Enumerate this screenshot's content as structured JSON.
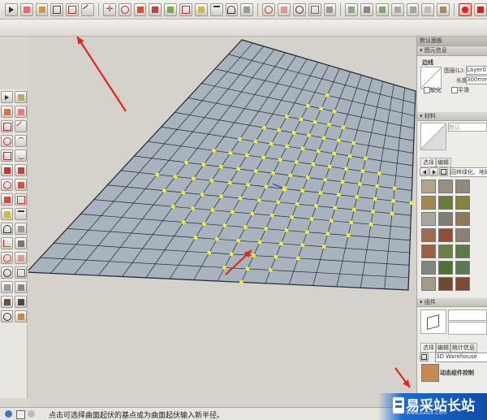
{
  "window": {
    "tray_title": "默认面板"
  },
  "entity_info": {
    "header": "图元信息",
    "type_label": "边线",
    "layer_label": "图层(L):",
    "layer_value": "Layer0",
    "length_label": "长度",
    "length_value": "300mm",
    "soften_label": "软化",
    "smooth_label": "平滑"
  },
  "materials": {
    "header": "材料",
    "name_placeholder": "默认",
    "tab_select": "选择",
    "tab_edit": "编辑",
    "library_value": "园林绿化、地砖",
    "swatches": [
      "#b6a489",
      "#958f84",
      "#8f8a7a",
      "#a0894e",
      "#6a7d3f",
      "#84853d",
      "#a7a69f",
      "#7e7e74",
      "#8b7b5c",
      "#a06a4e",
      "#8f4d3a",
      "#8b8178",
      "#9c5f43",
      "#6a8046",
      "#5b7a48",
      "#7e8780",
      "#4e6f36",
      "#5c7a52",
      "#a49a86",
      "#6f4a2f",
      "#7b4c32"
    ]
  },
  "components": {
    "header": "组件",
    "tab_select": "选择",
    "tab_edit": "编辑",
    "tab_stats": "统计信息",
    "search_value": "3D Warehouse",
    "item_label": "动态组件控制"
  },
  "status": {
    "hint": "点击可选择曲面起伏的基点或为曲面起伏输入新半径。"
  },
  "watermark": {
    "site_name": "易采站长站",
    "site_url": "Www.Easck.Com"
  },
  "colors": {
    "grid_fill": "#a9b3bd",
    "grid_line": "#1f2a36",
    "vertex": "#f5ee2a",
    "arrow": "#e3261a"
  }
}
